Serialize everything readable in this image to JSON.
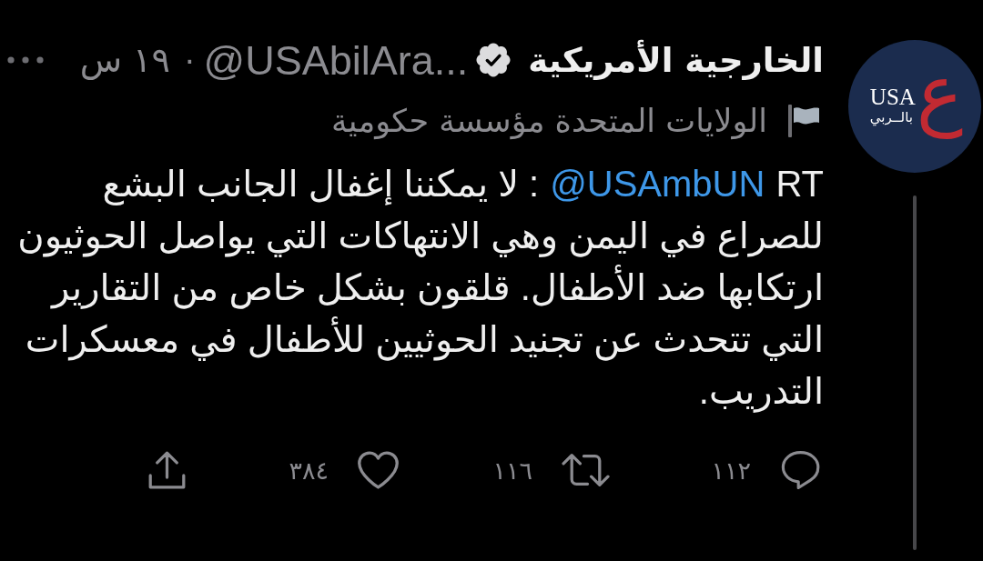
{
  "account": {
    "name": "الخارجية الأمريكية",
    "verified": true,
    "handle": "@USAbilAra...",
    "separator": "·",
    "time": "١٩ س",
    "label": "الولايات المتحدة مؤسسة حكومية"
  },
  "avatar": {
    "logo_text": "USA",
    "logo_letter": "ع",
    "logo_tagline": "بالــربي"
  },
  "tweet": {
    "segments": [
      {
        "kind": "text",
        "text": "RT"
      },
      {
        "kind": "mention",
        "text": "@USAmbUN"
      },
      {
        "kind": "text",
        "text": ": لا يمكننا إغفال الجانب البشع للصراع في اليمن وهي الانتهاكات التي يواصل الحوثيون ارتكابها ضد الأطفال. قلقون بشكل خاص من التقارير التي تتحدث عن تجنيد الحوثيين للأطفال في معسكرات التدريب."
      }
    ]
  },
  "actions": [
    {
      "kind": "reply",
      "count": "١١٢"
    },
    {
      "kind": "retweet",
      "count": "١١٦"
    },
    {
      "kind": "like",
      "count": "٣٨٤"
    },
    {
      "kind": "share"
    }
  ]
}
